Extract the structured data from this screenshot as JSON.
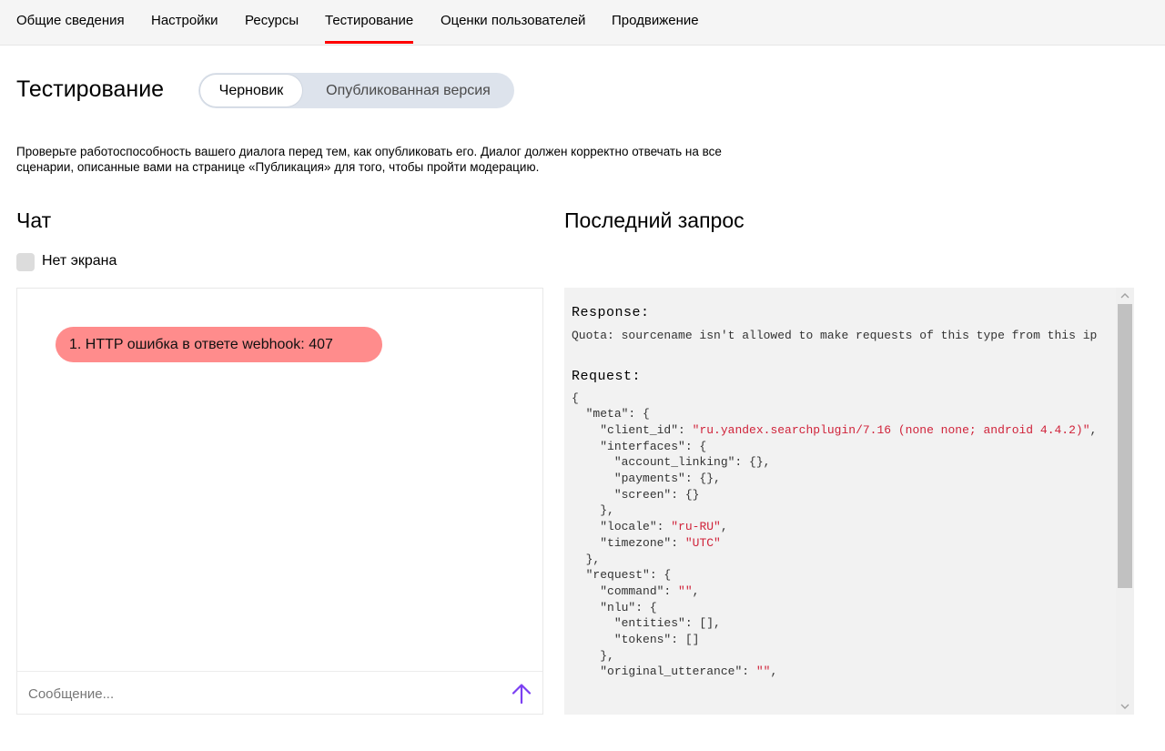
{
  "nav": {
    "tabs": [
      {
        "label": "Общие сведения"
      },
      {
        "label": "Настройки"
      },
      {
        "label": "Ресурсы"
      },
      {
        "label": "Тестирование"
      },
      {
        "label": "Оценки пользователей"
      },
      {
        "label": "Продвижение"
      }
    ],
    "active_tab": "Тестирование",
    "accent_color": "#ff0000"
  },
  "header": {
    "title": "Тестирование",
    "version_switch": {
      "options": [
        "Черновик",
        "Опубликованная версия"
      ],
      "selected": "Черновик"
    }
  },
  "description": "Проверьте работоспособность вашего диалога перед тем, как опубликовать его. Диалог должен корректно отвечать на все сценарии, описанные вами на странице «Публикация» для того, чтобы пройти модерацию.",
  "chat": {
    "title": "Чат",
    "no_screen_label": "Нет экрана",
    "no_screen_checked": false,
    "messages": [
      {
        "text": "1. HTTP ошибка в ответе webhook: 407",
        "color": "#ff8c8c"
      }
    ],
    "input_placeholder": "Сообщение...",
    "send_icon": "arrow-up-icon",
    "send_icon_color": "#7b3ff2"
  },
  "last_request": {
    "title": "Последний запрос",
    "response_label": "Response:",
    "response_text": "Quota: sourcename isn't allowed to make requests of this type from this ip",
    "request_label": "Request:",
    "code_lines": [
      [
        {
          "t": "{"
        }
      ],
      [
        {
          "t": "  \"meta\": {"
        }
      ],
      [
        {
          "t": "    \"client_id\": "
        },
        {
          "t": "\"ru.yandex.searchplugin/7.16 (none none; android 4.4.2)\"",
          "s": true
        },
        {
          "t": ","
        }
      ],
      [
        {
          "t": "    \"interfaces\": {"
        }
      ],
      [
        {
          "t": "      \"account_linking\": {},"
        }
      ],
      [
        {
          "t": "      \"payments\": {},"
        }
      ],
      [
        {
          "t": "      \"screen\": {}"
        }
      ],
      [
        {
          "t": "    },"
        }
      ],
      [
        {
          "t": "    \"locale\": "
        },
        {
          "t": "\"ru-RU\"",
          "s": true
        },
        {
          "t": ","
        }
      ],
      [
        {
          "t": "    \"timezone\": "
        },
        {
          "t": "\"UTC\"",
          "s": true
        }
      ],
      [
        {
          "t": "  },"
        }
      ],
      [
        {
          "t": "  \"request\": {"
        }
      ],
      [
        {
          "t": "    \"command\": "
        },
        {
          "t": "\"\"",
          "s": true
        },
        {
          "t": ","
        }
      ],
      [
        {
          "t": "    \"nlu\": {"
        }
      ],
      [
        {
          "t": "      \"entities\": [],"
        }
      ],
      [
        {
          "t": "      \"tokens\": []"
        }
      ],
      [
        {
          "t": "    },"
        }
      ],
      [
        {
          "t": "    \"original_utterance\": "
        },
        {
          "t": "\"\"",
          "s": true
        },
        {
          "t": ","
        }
      ]
    ],
    "string_color": "#d0233a"
  }
}
